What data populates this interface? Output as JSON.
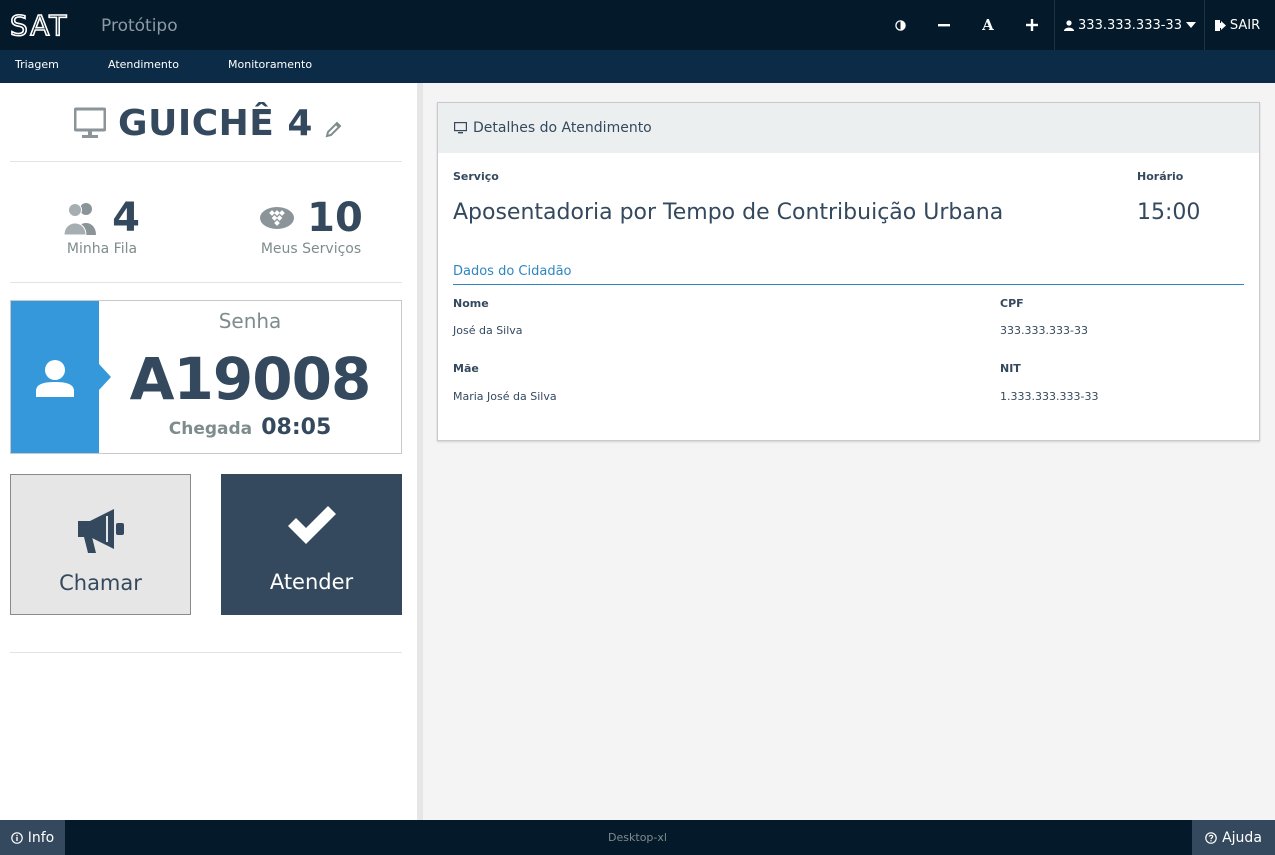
{
  "header": {
    "logo_text": "SAT",
    "subtitle": "Protótipo",
    "contrast_icon": "contrast-icon",
    "decrease_font_icon": "minus-icon",
    "font_label": "A",
    "increase_font_icon": "plus-icon",
    "user": "333.333.333-33",
    "exit_label": "SAIR"
  },
  "nav": {
    "items": [
      "Triagem",
      "Atendimento",
      "Monitoramento"
    ]
  },
  "left": {
    "guiche_title": "GUICHÊ 4",
    "stats": {
      "fila_value": "4",
      "fila_label": "Minha Fila",
      "servicos_value": "10",
      "servicos_label": "Meus Serviços"
    },
    "ticket": {
      "senha_label": "Senha",
      "senha_value": "A19008",
      "chegada_label": "Chegada",
      "chegada_value": "08:05"
    },
    "buttons": {
      "chamar": "Chamar",
      "atender": "Atender"
    }
  },
  "details": {
    "title": "Detalhes do Atendimento",
    "servico_label": "Serviço",
    "servico_value": "Aposentadoria por Tempo de Contribuição Urbana",
    "horario_label": "Horário",
    "horario_value": "15:00",
    "cidadao_title": "Dados do Cidadão",
    "nome_label": "Nome",
    "nome_value": "José da Silva",
    "cpf_label": "CPF",
    "cpf_value": "333.333.333-33",
    "mae_label": "Mãe",
    "mae_value": "Maria José da Silva",
    "nit_label": "NIT",
    "nit_value": "1.333.333.333-33"
  },
  "footer": {
    "info_label": "Info",
    "center_text": "Desktop-xl",
    "help_label": "Ajuda"
  },
  "colors": {
    "header_bg": "#04192a",
    "nav_bg": "#0b2b46",
    "accent_blue": "#3498db",
    "dark_slate": "#34495e",
    "link_blue": "#2e86c1"
  }
}
